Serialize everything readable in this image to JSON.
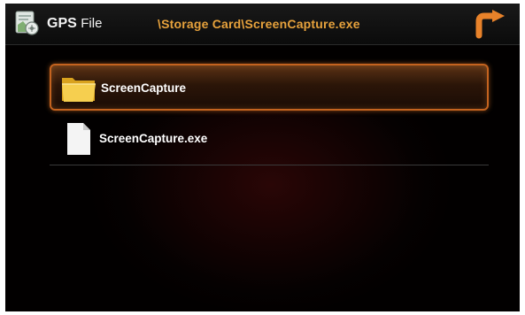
{
  "header": {
    "title_main": "GPS",
    "title_sub": "File",
    "path": "\\Storage Card\\ScreenCapture.exe",
    "app_icon": "gps-file-icon",
    "back_icon": "back-arrow-icon",
    "accent_color": "#e7a23c"
  },
  "files": [
    {
      "name": "ScreenCapture",
      "type": "folder",
      "icon": "folder-icon",
      "selected": true
    },
    {
      "name": "ScreenCapture.exe",
      "type": "file",
      "icon": "file-icon",
      "selected": false
    }
  ]
}
